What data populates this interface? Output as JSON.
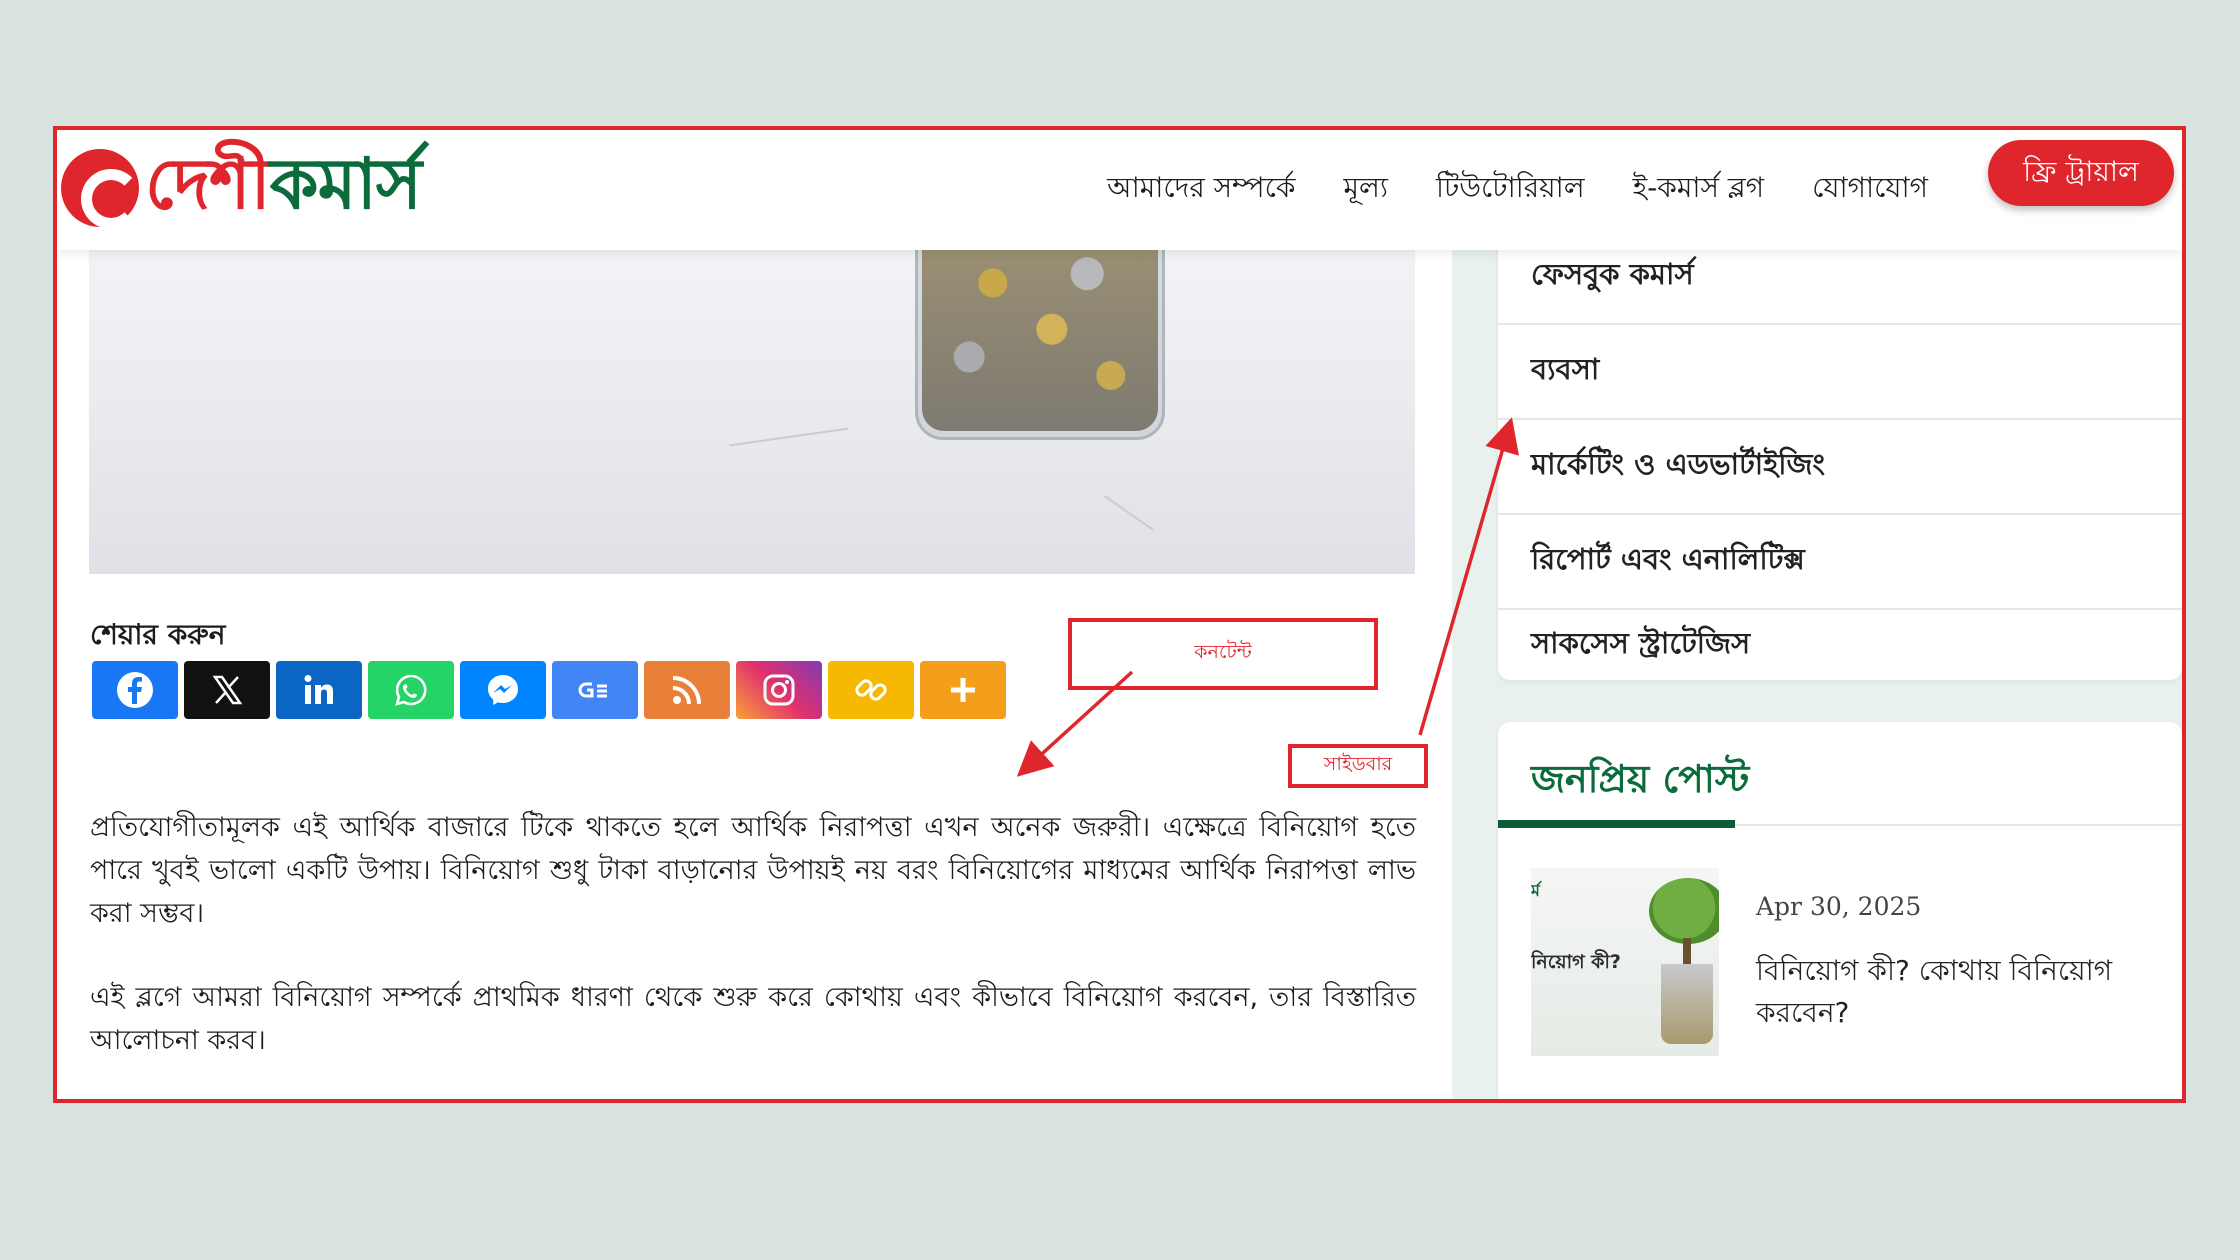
{
  "header": {
    "logo_text_red": "দেশী",
    "logo_text_green": "কমার্স",
    "nav": [
      "আমাদের সম্পর্কে",
      "মূল্য",
      "টিউটোরিয়াল",
      "ই-কমার্স ব্লগ",
      "যোগাযোগ"
    ],
    "cta_label": "ফ্রি ট্রায়াল"
  },
  "content": {
    "share_title": "শেয়ার করুন",
    "share_buttons": [
      {
        "icon": "facebook-icon",
        "color": "#1877f2"
      },
      {
        "icon": "x-icon",
        "color": "#111111"
      },
      {
        "icon": "linkedin-icon",
        "color": "#0a66c2"
      },
      {
        "icon": "whatsapp-icon",
        "color": "#25d366"
      },
      {
        "icon": "messenger-icon",
        "color": "#0084ff"
      },
      {
        "icon": "google-news-icon",
        "color": "#4285f4"
      },
      {
        "icon": "rss-icon",
        "color": "#e8803a"
      },
      {
        "icon": "instagram-icon",
        "color": "#c13584"
      },
      {
        "icon": "copy-link-icon",
        "color": "#f6b800"
      },
      {
        "icon": "more-icon",
        "color": "#f59e1b"
      }
    ],
    "paragraph1": "প্রতিযোগীতামূলক এই আর্থিক বাজারে টিকে থাকতে হলে আর্থিক নিরাপত্তা এখন অনেক জরুরী। এক্ষেত্রে বিনিয়োগ হতে পারে খুবই ভালো একটি উপায়। বিনিয়োগ শুধু টাকা বাড়ানোর উপায়ই নয় বরং বিনিয়োগের মাধ্যমের আর্থিক নিরাপত্তা লাভ করা সম্ভব।",
    "paragraph2": "এই ব্লগে আমরা বিনিয়োগ সম্পর্কে প্রাথমিক ধারণা থেকে শুরু করে কোথায় এবং কীভাবে বিনিয়োগ করবেন, তার বিস্তারিত আলোচনা করব।"
  },
  "sidebar": {
    "categories": [
      "ফেসবুক কমার্স",
      "ব্যবসা",
      "মার্কেটিং ও এডভার্টাইজিং",
      "রিপোর্ট এবং এনালিটিক্স",
      "সাকসেস স্ট্রাটেজিস"
    ],
    "popular_title": "জনপ্রিয় পোস্ট",
    "post": {
      "date": "Apr 30, 2025",
      "title": "বিনিয়োগ কী? কোথায় বিনিয়োগ করবেন?",
      "thumb_text": "নিয়োগ কী?"
    }
  },
  "annotations": {
    "content_label": "কনটেন্ট",
    "sidebar_label": "সাইডবার"
  },
  "colors": {
    "brand_red": "#e0262d",
    "brand_green": "#0b6b3a",
    "sidebar_bg": "#e8f1ee"
  }
}
